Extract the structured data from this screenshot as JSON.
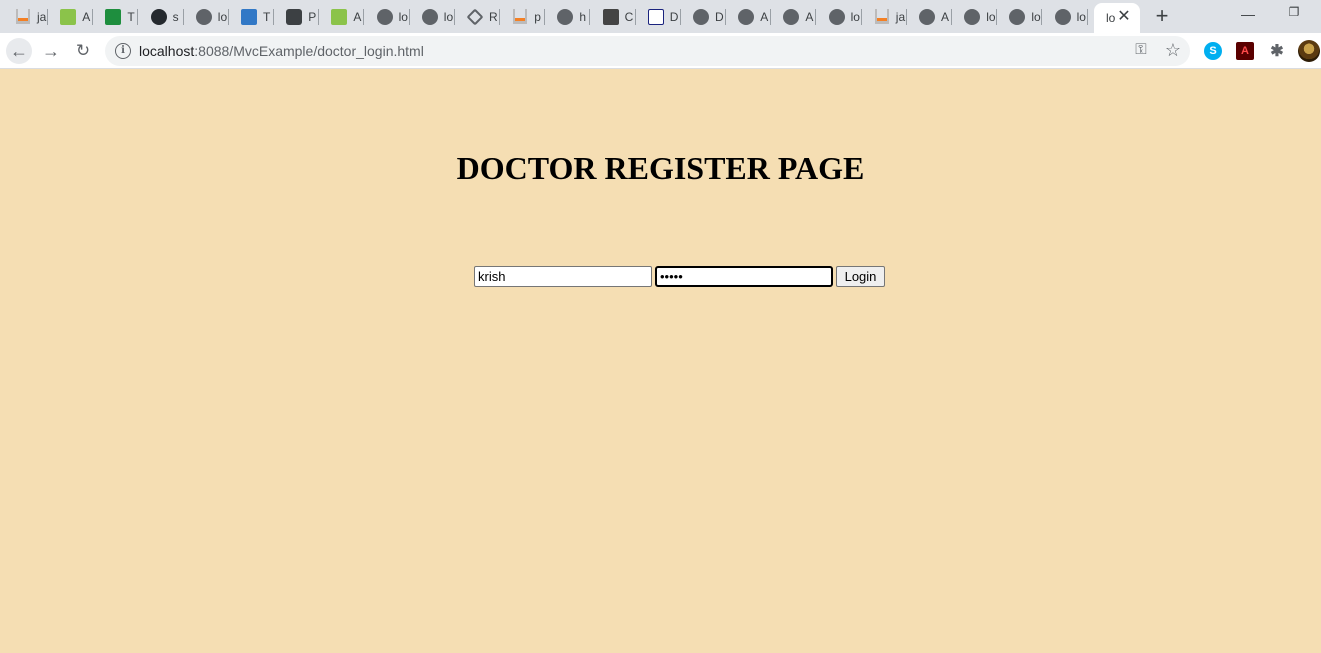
{
  "tabs": [
    {
      "favicon": "stackoverflow-icon",
      "label": "ja"
    },
    {
      "favicon": "w3schools-icon",
      "label": "A"
    },
    {
      "favicon": "tc-icon",
      "label": "T"
    },
    {
      "favicon": "github-icon",
      "label": "s"
    },
    {
      "favicon": "globe-icon",
      "label": "lo"
    },
    {
      "favicon": "typescript-icon",
      "label": "T"
    },
    {
      "favicon": "pocket-icon",
      "label": "P"
    },
    {
      "favicon": "w3schools-icon",
      "label": "A"
    },
    {
      "favicon": "globe-icon",
      "label": "lo"
    },
    {
      "favicon": "globe-icon",
      "label": "lo"
    },
    {
      "favicon": "diamond-icon",
      "label": "R"
    },
    {
      "favicon": "stackoverflow-icon",
      "label": "p"
    },
    {
      "favicon": "globe-icon",
      "label": "h"
    },
    {
      "favicon": "jboss-icon",
      "label": "C"
    },
    {
      "favicon": "dj-icon",
      "label": "D"
    },
    {
      "favicon": "globe-icon",
      "label": "D"
    },
    {
      "favicon": "globe-icon",
      "label": "A"
    },
    {
      "favicon": "globe-icon",
      "label": "A"
    },
    {
      "favicon": "globe-icon",
      "label": "lo"
    },
    {
      "favicon": "stackoverflow-icon",
      "label": "ja"
    },
    {
      "favicon": "globe-icon",
      "label": "A"
    },
    {
      "favicon": "globe-icon",
      "label": "lo"
    },
    {
      "favicon": "globe-icon",
      "label": "lo"
    },
    {
      "favicon": "globe-icon",
      "label": "lo"
    }
  ],
  "active_tab": {
    "label": "lo"
  },
  "address_bar": {
    "host": "localhost",
    "path": ":8088/MvcExample/doctor_login.html"
  },
  "page": {
    "heading": "DOCTOR REGISTER PAGE",
    "username_value": "krish",
    "password_value": "•••••",
    "login_label": "Login"
  },
  "colors": {
    "page_background": "#f5deb3"
  }
}
